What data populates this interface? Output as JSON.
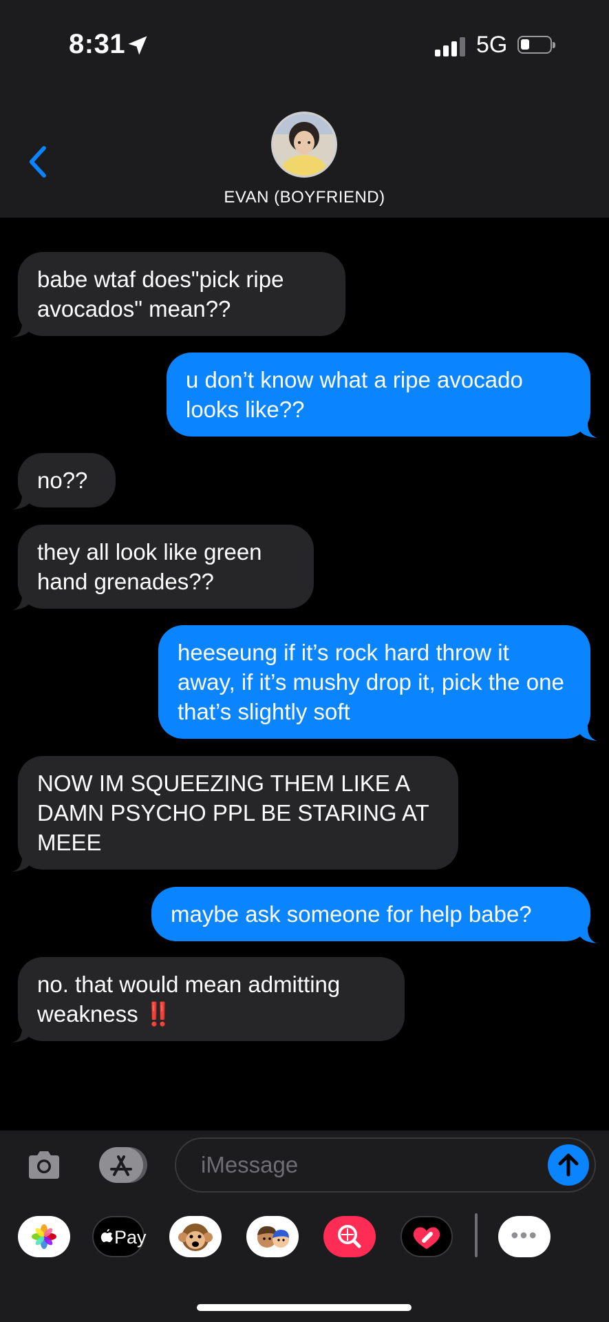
{
  "status_bar": {
    "time": "8:31",
    "network": "5G"
  },
  "header": {
    "contact_name": "EVAN (BOYFRIEND)"
  },
  "messages": [
    {
      "dir": "in",
      "text": "babe wtaf does\"pick ripe avocados\" mean??"
    },
    {
      "dir": "out",
      "text": "u don’t know what a ripe avocado looks like??"
    },
    {
      "dir": "in",
      "text": "no??"
    },
    {
      "dir": "in",
      "text": "they all look like green hand grenades??"
    },
    {
      "dir": "out",
      "text": "heeseung if it’s rock hard throw it away, if it’s mushy drop it, pick the one that’s slightly soft"
    },
    {
      "dir": "in",
      "text": "NOW IM SQUEEZING THEM LIKE A DAMN PSYCHO PPL BE STARING AT MEEE"
    },
    {
      "dir": "out",
      "text": "maybe ask someone for help babe?"
    },
    {
      "dir": "in",
      "text": "no. that would mean admitting weakness",
      "emoji": "‼️"
    }
  ],
  "input": {
    "placeholder": "iMessage"
  },
  "drawer": {
    "apps": [
      "photos-app",
      "apple-pay-app",
      "animoji-app",
      "memoji-app",
      "image-search-app",
      "digital-touch-app",
      "more-apps"
    ],
    "apple_pay_label": "Pay",
    "more_label": "•••"
  },
  "colors": {
    "incoming_bubble": "#262628",
    "outgoing_bubble": "#0a84ff",
    "header_bg": "#1c1c1e"
  }
}
